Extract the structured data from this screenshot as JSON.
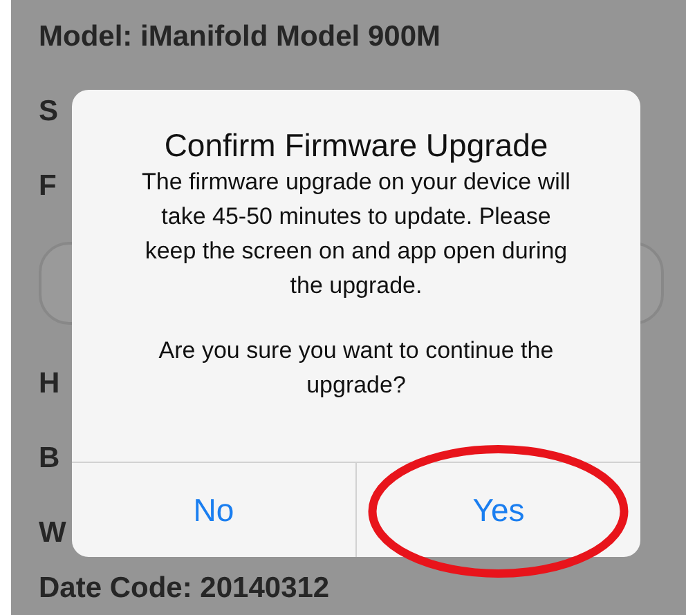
{
  "background": {
    "rows": [
      {
        "kind": "text",
        "label": "Model: iManifold Model 900M"
      },
      {
        "kind": "text",
        "label": "S"
      },
      {
        "kind": "text",
        "label": "F"
      },
      {
        "kind": "field"
      },
      {
        "kind": "text",
        "label": "H"
      },
      {
        "kind": "text",
        "label": "B"
      },
      {
        "kind": "text",
        "label": "W"
      },
      {
        "kind": "text",
        "label": "Date Code: 20140312"
      }
    ]
  },
  "dialog": {
    "title": "Confirm Firmware Upgrade",
    "message": [
      "The firmware upgrade on your device will take 45-50 minutes to update. Please keep the screen on and app open during the upgrade.",
      "Are you sure you want to continue the upgrade?"
    ],
    "buttons": [
      {
        "label": "No",
        "circled": false
      },
      {
        "label": "Yes",
        "circled": true
      }
    ]
  }
}
